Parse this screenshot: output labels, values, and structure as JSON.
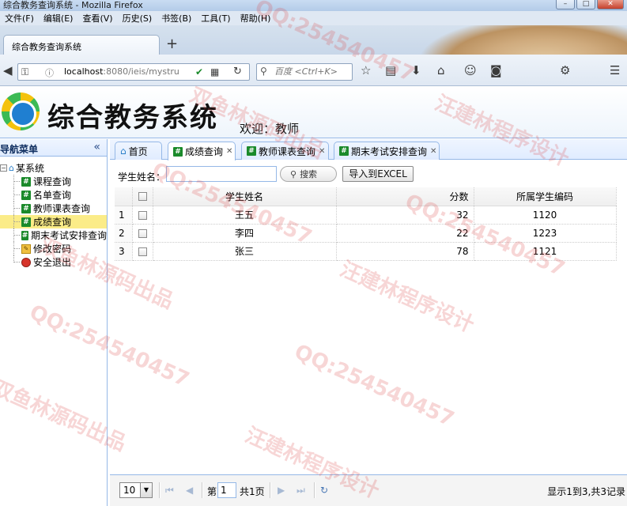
{
  "browser": {
    "window_title": "综合教务查询系统 - Mozilla Firefox",
    "menu": [
      "文件(F)",
      "编辑(E)",
      "查看(V)",
      "历史(S)",
      "书签(B)",
      "工具(T)",
      "帮助(H)"
    ],
    "tab_title": "综合教务查询系统",
    "new_tab": "+",
    "url_host": "localhost",
    "url_rest": ":8080/ieis/mystru",
    "search_placeholder": "百度 <Ctrl+K>"
  },
  "app": {
    "title": "综合教务系统",
    "welcome": "欢迎：教师"
  },
  "west": {
    "title": "导航菜单",
    "collapse_glyph": "«",
    "root_label": "某系统",
    "items": [
      {
        "label": "课程查询",
        "icon": "hash-icon"
      },
      {
        "label": "名单查询",
        "icon": "hash-icon"
      },
      {
        "label": "教师课表查询",
        "icon": "hash-icon"
      },
      {
        "label": "成绩查询",
        "icon": "hash-icon",
        "selected": true
      },
      {
        "label": "期末考试安排查询",
        "icon": "hash-icon"
      },
      {
        "label": "修改密码",
        "icon": "key-icon"
      },
      {
        "label": "安全退出",
        "icon": "exit-icon"
      }
    ]
  },
  "tabs": [
    {
      "label": "首页",
      "closable": false
    },
    {
      "label": "成绩查询",
      "closable": true,
      "active": true
    },
    {
      "label": "教师课表查询",
      "closable": true
    },
    {
      "label": "期末考试安排查询",
      "closable": true
    }
  ],
  "toolbar": {
    "student_name_label": "学生姓名：",
    "student_name_value": "",
    "search_label": "搜索",
    "export_label": "导入到EXCEL"
  },
  "grid": {
    "columns": [
      "学生姓名",
      "分数",
      "所属学生编码"
    ],
    "rows": [
      {
        "num": "1",
        "name": "王五",
        "score": "32",
        "code": "1120"
      },
      {
        "num": "2",
        "name": "李四",
        "score": "22",
        "code": "1223"
      },
      {
        "num": "3",
        "name": "张三",
        "score": "78",
        "code": "1121"
      }
    ]
  },
  "pager": {
    "page_size": "10",
    "page_label": "第",
    "page_value": "1",
    "total_pages": "共1页",
    "info": "显示1到3,共3记录"
  },
  "watermarks": {
    "qq": "QQ:254540457",
    "jianlin": "汪建林程序设计",
    "shuangyu": "双鱼林源码出品"
  }
}
